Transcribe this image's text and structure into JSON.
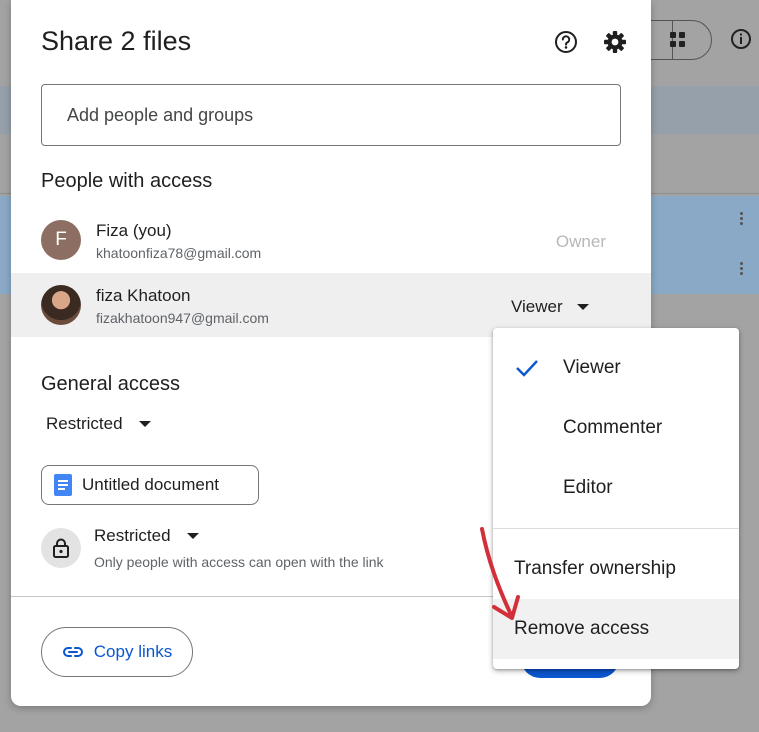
{
  "dialog": {
    "title": "Share 2 files",
    "help_icon": "help-circle-icon",
    "settings_icon": "gear-icon",
    "add_people_placeholder": "Add people and groups",
    "people_heading": "People with access",
    "people": [
      {
        "avatar_letter": "F",
        "avatar_color": "#8d6e63",
        "name": "Fiza (you)",
        "email": "khatoonfiza78@gmail.com",
        "role": "Owner"
      },
      {
        "avatar_type": "photo",
        "name": "fiza Khatoon",
        "email": "fizakhatoon947@gmail.com",
        "role": "Viewer"
      }
    ],
    "general_access_heading": "General access",
    "general_access_selector": "Restricted",
    "document_chip": "Untitled document",
    "access_level": "Restricted",
    "access_description": "Only people with access can open with the link",
    "copy_links_label": "Copy links"
  },
  "role_menu": {
    "items": [
      {
        "label": "Viewer",
        "selected": true
      },
      {
        "label": "Commenter",
        "selected": false
      },
      {
        "label": "Editor",
        "selected": false
      }
    ],
    "actions": [
      {
        "label": "Transfer ownership"
      },
      {
        "label": "Remove access",
        "highlighted": true
      }
    ]
  },
  "colors": {
    "accent": "#0b57d0",
    "annotation_arrow": "#d32f3b",
    "doc_icon": "#4285f4"
  }
}
